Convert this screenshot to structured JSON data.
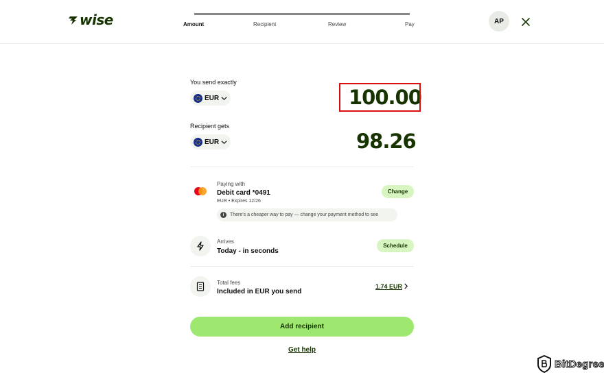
{
  "header": {
    "logo_text": "7WISE",
    "logo_display": "wise",
    "steps": [
      "Amount",
      "Recipient",
      "Review",
      "Pay"
    ],
    "active_step": "Amount",
    "avatar_initials": "AP",
    "brand_color": "#163300",
    "accent_color": "#9fe870"
  },
  "send": {
    "label": "You send exactly",
    "currency": "EUR",
    "amount": "100.00"
  },
  "receive": {
    "label": "Recipient gets",
    "currency": "EUR",
    "amount": "98.26"
  },
  "payment": {
    "label": "Paying with",
    "method": "Debit card *0491",
    "details": "EUR • Expires 12/26",
    "change_label": "Change",
    "notice": "There's a cheaper way to pay — change your payment method to see",
    "icon": "mastercard-icon"
  },
  "arrival": {
    "label": "Arrives",
    "value": "Today - in seconds",
    "schedule_label": "Schedule",
    "icon": "lightning-icon"
  },
  "fees": {
    "label": "Total fees",
    "value": "Included in EUR you send",
    "amount": "1.74 EUR",
    "icon": "receipt-icon"
  },
  "actions": {
    "primary": "Add recipient",
    "help": "Get help"
  },
  "watermark": {
    "text": "BitDegree"
  }
}
